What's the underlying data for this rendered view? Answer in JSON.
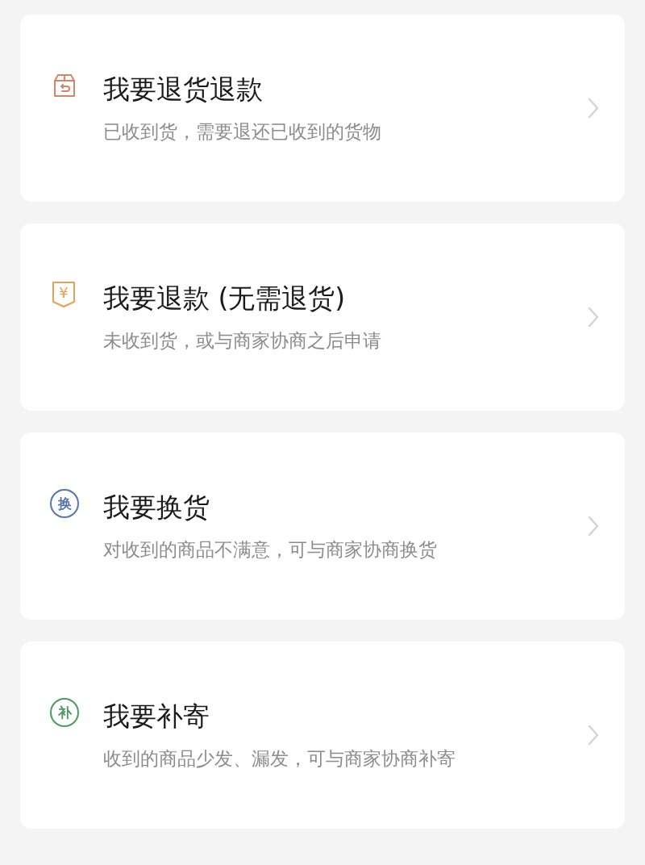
{
  "options": [
    {
      "kind": "box",
      "color": "#d9826a",
      "title": "我要退货退款",
      "subtitle": "已收到货，需要退还已收到的货物"
    },
    {
      "kind": "yuan",
      "color": "#e8a150",
      "icon_text": "¥",
      "title": "我要退款 (无需退货)",
      "subtitle": "未收到货，或与商家协商之后申请"
    },
    {
      "kind": "circle",
      "color": "#5877a8",
      "icon_text": "换",
      "title": "我要换货",
      "subtitle": "对收到的商品不满意，可与商家协商换货"
    },
    {
      "kind": "circle",
      "color": "#4d9a5e",
      "icon_text": "补",
      "title": "我要补寄",
      "subtitle": "收到的商品少发、漏发，可与商家协商补寄"
    }
  ]
}
